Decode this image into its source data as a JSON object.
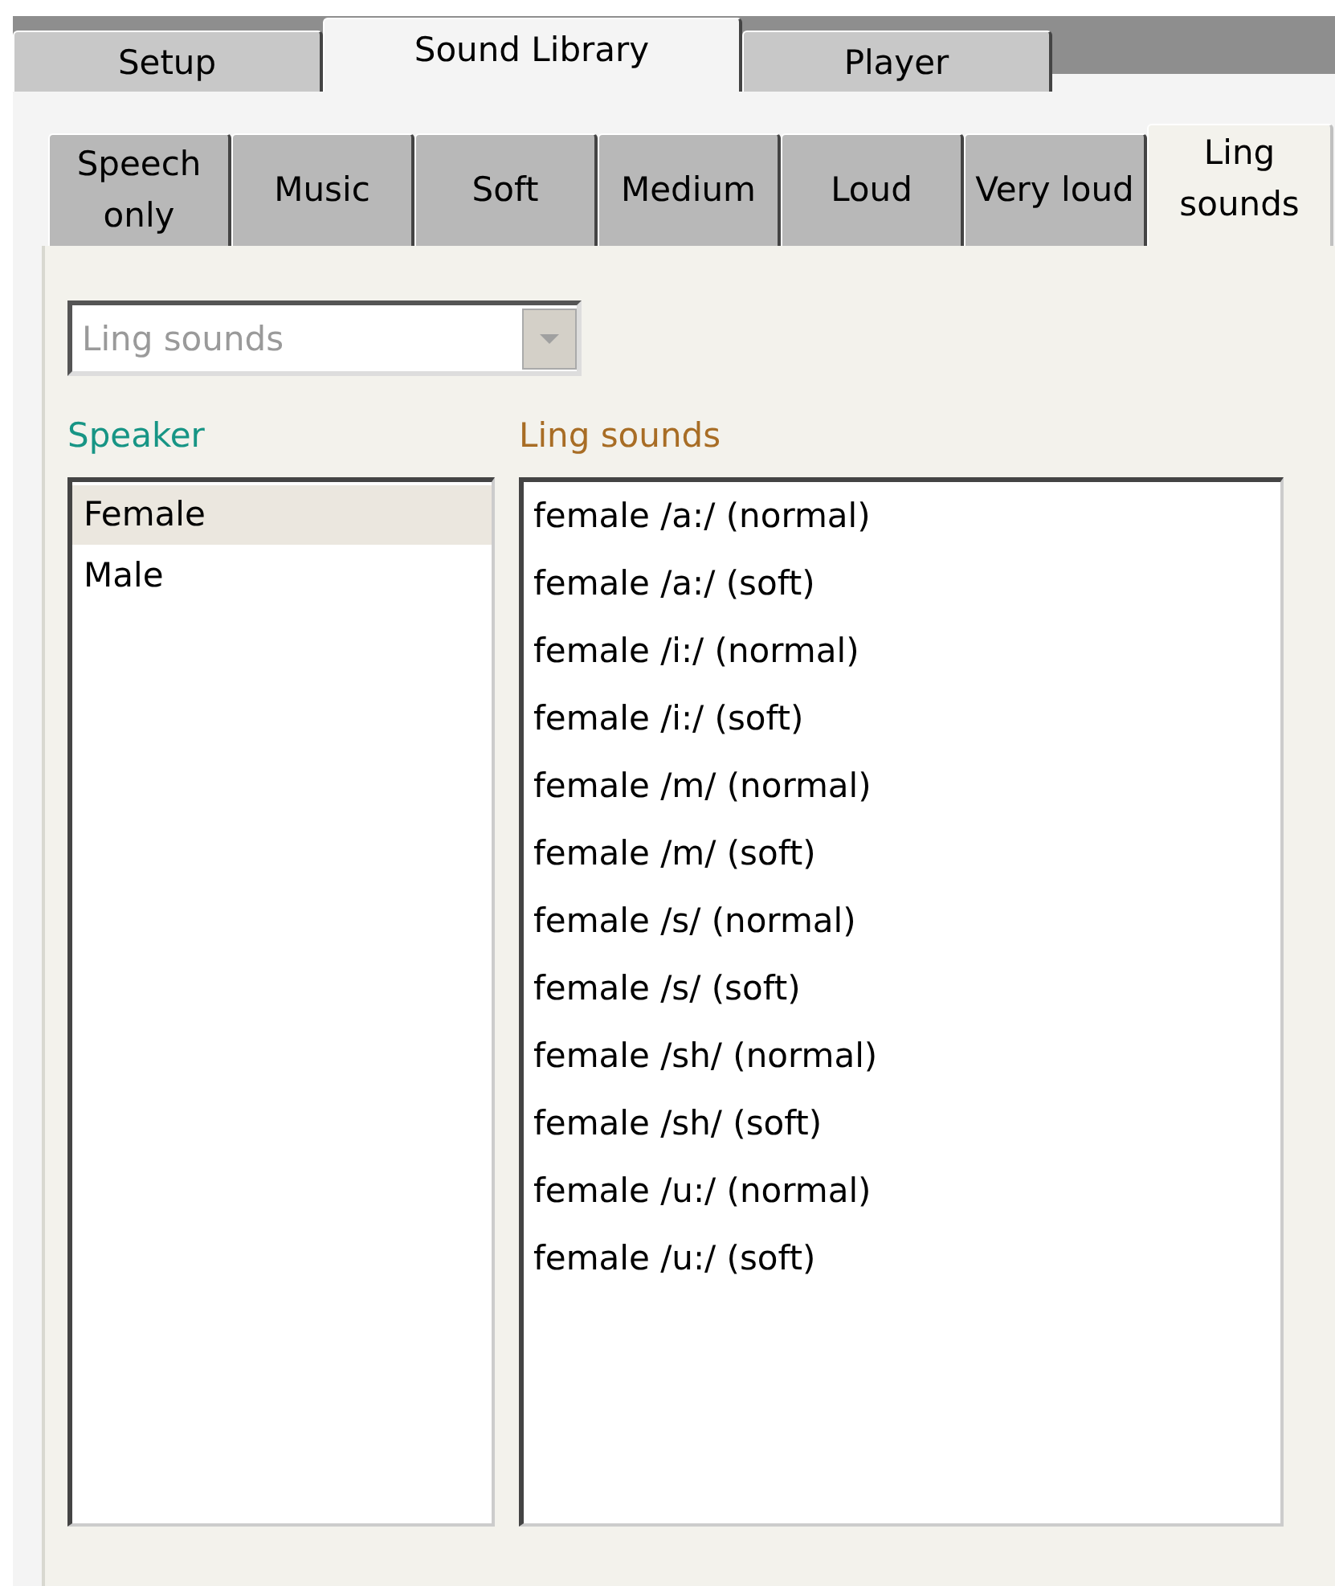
{
  "main_tabs": [
    {
      "label": "Setup",
      "selected": false
    },
    {
      "label": "Sound Library",
      "selected": true
    },
    {
      "label": "Player",
      "selected": false
    }
  ],
  "category_tabs": [
    {
      "label": "Speech only",
      "selected": false
    },
    {
      "label": "Music",
      "selected": false
    },
    {
      "label": "Soft",
      "selected": false
    },
    {
      "label": "Medium",
      "selected": false
    },
    {
      "label": "Loud",
      "selected": false
    },
    {
      "label": "Very loud",
      "selected": false
    },
    {
      "label": "Ling sounds",
      "selected": true
    }
  ],
  "dropdown": {
    "value": "Ling sounds",
    "disabled": true
  },
  "speaker": {
    "label": "Speaker",
    "items": [
      {
        "label": "Female",
        "selected": true
      },
      {
        "label": "Male",
        "selected": false
      }
    ]
  },
  "sounds": {
    "label": "Ling sounds",
    "items": [
      {
        "label": "female /a:/ (normal)",
        "selected": false
      },
      {
        "label": "female /a:/ (soft)",
        "selected": false
      },
      {
        "label": "female /i:/ (normal)",
        "selected": false
      },
      {
        "label": "female /i:/ (soft)",
        "selected": false
      },
      {
        "label": "female /m/ (normal)",
        "selected": false
      },
      {
        "label": "female /m/ (soft)",
        "selected": false
      },
      {
        "label": "female /s/ (normal)",
        "selected": false
      },
      {
        "label": "female /s/ (soft)",
        "selected": false
      },
      {
        "label": "female /sh/ (normal)",
        "selected": false
      },
      {
        "label": "female /sh/ (soft)",
        "selected": false
      },
      {
        "label": "female /u:/ (normal)",
        "selected": false
      },
      {
        "label": "female /u:/ (soft)",
        "selected": false
      }
    ]
  }
}
